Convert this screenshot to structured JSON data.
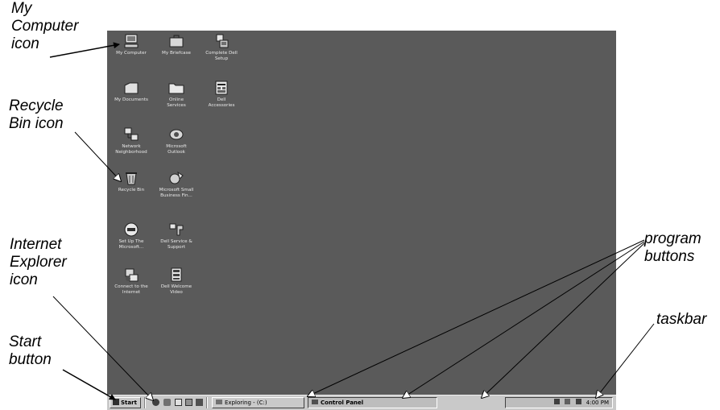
{
  "callouts": {
    "my_computer": "My\nComputer\nicon",
    "recycle_bin": "Recycle\nBin icon",
    "internet_explorer": "Internet\nExplorer\nicon",
    "start_button": "Start\nbutton",
    "program_buttons": "program\nbuttons",
    "taskbar": "taskbar"
  },
  "desktop": {
    "background": "#5a5a5a",
    "icons": [
      {
        "label": "My Computer",
        "icon": "computer-icon"
      },
      {
        "label": "My Briefcase",
        "icon": "briefcase-icon"
      },
      {
        "label": "Complete Dell\nSetup",
        "icon": "setup-icon"
      },
      {
        "label": "My Documents",
        "icon": "documents-icon"
      },
      {
        "label": "Online\nServices",
        "icon": "folder-icon"
      },
      {
        "label": "Dell\nAccessories",
        "icon": "accessories-icon"
      },
      {
        "label": "Network\nNeighborhood",
        "icon": "network-icon"
      },
      {
        "label": "Microsoft\nOutlook",
        "icon": "outlook-icon"
      },
      {
        "label": "Recycle Bin",
        "icon": "recycle-bin-icon"
      },
      {
        "label": "Microsoft Small\nBusiness Fin...",
        "icon": "business-icon"
      },
      {
        "label": "Set Up The\nMicrosoft...",
        "icon": "msn-icon"
      },
      {
        "label": "Dell Service &\nSupport",
        "icon": "support-icon"
      },
      {
        "label": "Connect to the\nInternet",
        "icon": "internet-explorer-icon"
      },
      {
        "label": "Dell Welcome\nVideo",
        "icon": "video-icon"
      }
    ]
  },
  "taskbar": {
    "start_label": "Start",
    "quick_launch": [
      "internet-explorer-icon",
      "outlook-icon",
      "desktop-icon",
      "channels-icon",
      "dell-icon"
    ],
    "programs": [
      {
        "label": "Exploring - (C:)",
        "active": false
      },
      {
        "label": "Control Panel",
        "active": true
      }
    ],
    "clock": "4:00 PM"
  }
}
